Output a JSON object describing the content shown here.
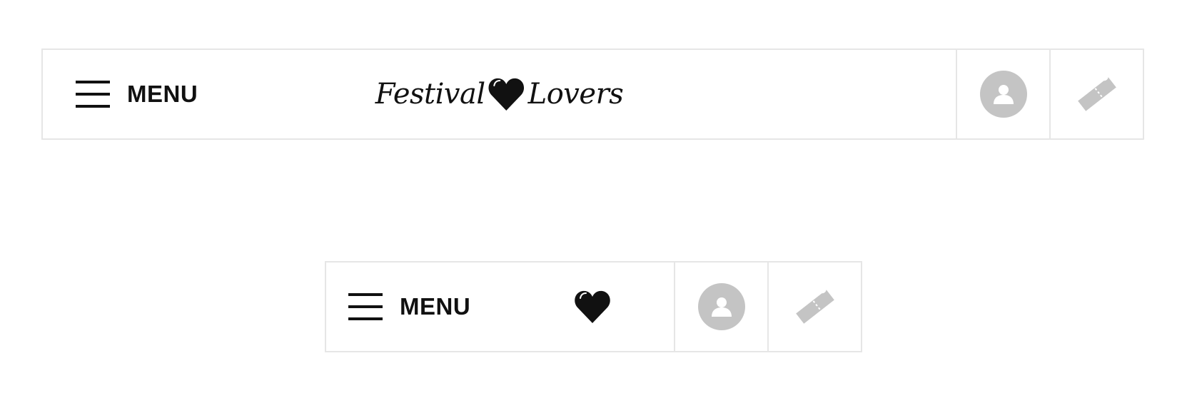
{
  "variants": {
    "wide": {
      "menu_label": "MENU",
      "logo": {
        "word_left": "Festival",
        "word_right": "Lovers",
        "heart_icon": "heart-icon"
      },
      "account_icon": "user-avatar-icon",
      "ticket_icon": "ticket-icon"
    },
    "compact": {
      "menu_label": "MENU",
      "logo": {
        "heart_icon": "heart-icon"
      },
      "account_icon": "user-avatar-icon",
      "ticket_icon": "ticket-icon"
    }
  },
  "colors": {
    "text": "#111111",
    "border": "#e6e6e6",
    "icon_gray": "#c4c4c4",
    "background": "#ffffff"
  }
}
